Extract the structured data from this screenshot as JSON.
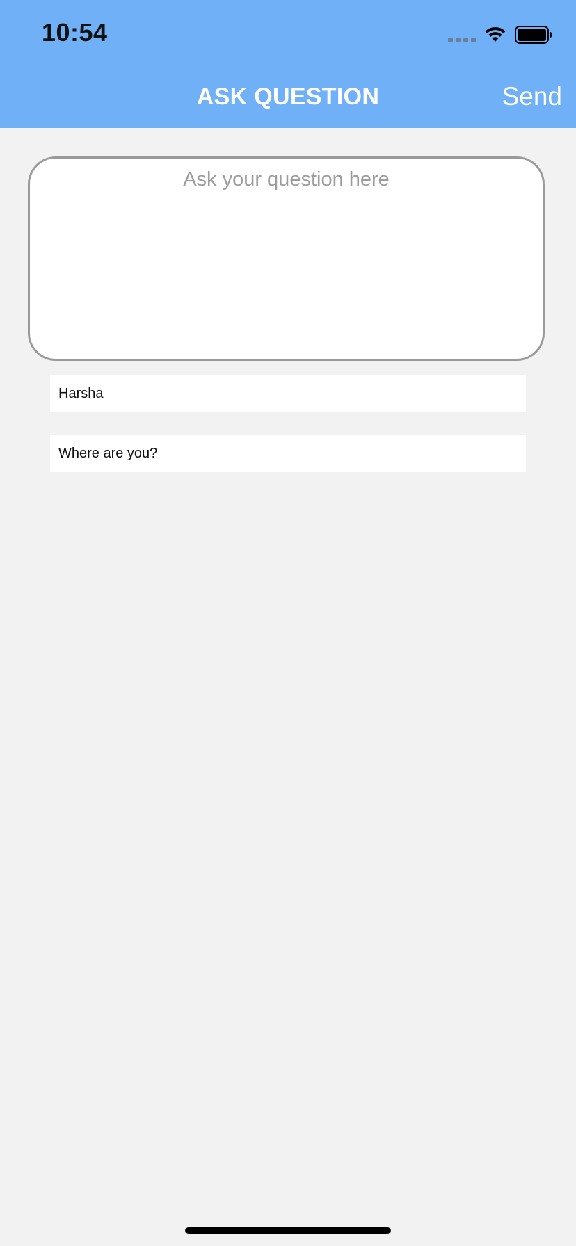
{
  "status_bar": {
    "time": "10:54",
    "icons": [
      "cellular-signal-icon",
      "wifi-icon",
      "battery-icon"
    ]
  },
  "nav": {
    "title": "ASK QUESTION",
    "send_label": "Send"
  },
  "question": {
    "value": "",
    "placeholder": "Ask your question here"
  },
  "fields": {
    "name_value": "Harsha",
    "location_value": "Where are you?"
  },
  "colors": {
    "header_background": "#6fb0f6",
    "page_background": "#f2f2f2",
    "box_border": "#9a9a9a"
  }
}
